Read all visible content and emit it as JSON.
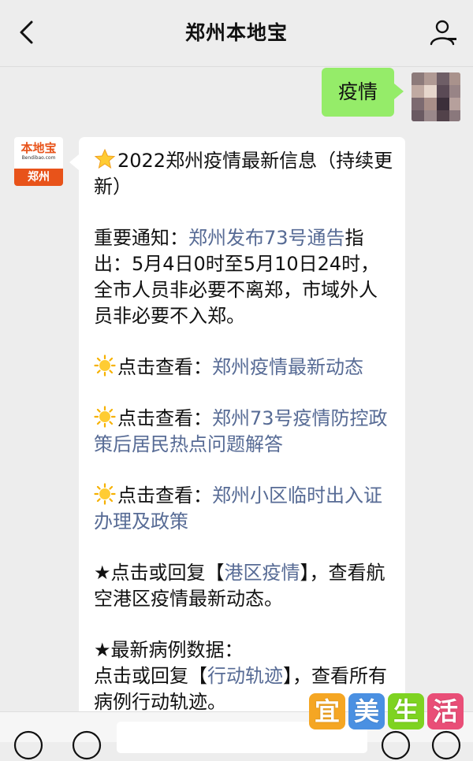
{
  "header": {
    "title": "郑州本地宝"
  },
  "user_message": {
    "text": "疫情"
  },
  "bot": {
    "avatar_logo": "本地宝",
    "avatar_url": "Bendibao.com",
    "avatar_city": "郑州"
  },
  "bot_message": {
    "title": "2022郑州疫情最新信息（持续更新）",
    "notice_prefix": "重要通知：",
    "notice_link": "郑州发布73号通告",
    "notice_text": "指出：5月4日0时至5月10日24时，全市人员非必要不离郑，市域外人员非必要不入郑。",
    "view1_prefix": "点击查看：",
    "view1_link": "郑州疫情最新动态",
    "view2_prefix": "点击查看：",
    "view2_link": "郑州73号疫情防控政策后居民热点问题解答",
    "view3_prefix": "点击查看：",
    "view3_link": "郑州小区临时出入证办理及政策",
    "star1_prefix": "★点击或回复【",
    "star1_link": "港区疫情",
    "star1_suffix": "】，查看航空港区疫情最新动态。",
    "star2_title": "★最新病例数据：",
    "star2_prefix": "点击或回复【",
    "star2_link": "行动轨迹",
    "star2_suffix": "】，查看所有病例行动轨迹。"
  },
  "watermark": {
    "chars": [
      "宜",
      "美",
      "生",
      "活"
    ],
    "colors": [
      "#f5a623",
      "#4a90e2",
      "#7ed321",
      "#e94e77"
    ]
  },
  "icons": {
    "back": "chevron-left-icon",
    "profile": "person-icon",
    "voice": "voice-icon",
    "keyboard": "keyboard-icon",
    "emoji": "emoji-icon",
    "plus": "plus-icon",
    "star": "star-emoji-icon",
    "sun": "sun-emoji-icon"
  },
  "colors": {
    "link": "#576b95",
    "user_bubble": "#95ec69",
    "background": "#ededed",
    "brand": "#e8531a"
  }
}
